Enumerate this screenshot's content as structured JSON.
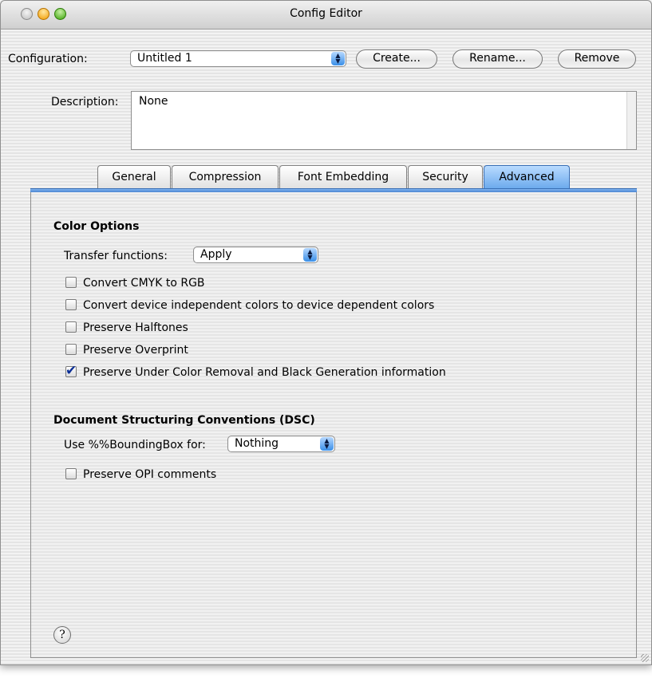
{
  "window": {
    "title": "Config Editor"
  },
  "configuration": {
    "label": "Configuration:",
    "value": "Untitled 1",
    "create_button": "Create...",
    "rename_button": "Rename...",
    "remove_button": "Remove"
  },
  "description": {
    "label": "Description:",
    "value": "None"
  },
  "tabs": [
    {
      "label": "General"
    },
    {
      "label": "Compression"
    },
    {
      "label": "Font Embedding"
    },
    {
      "label": "Security"
    },
    {
      "label": "Advanced",
      "selected": true
    }
  ],
  "color_options": {
    "heading": "Color Options",
    "transfer_label": "Transfer functions:",
    "transfer_value": "Apply",
    "checkboxes": [
      {
        "label": "Convert CMYK to RGB",
        "checked": false
      },
      {
        "label": "Convert device independent colors to device dependent colors",
        "checked": false
      },
      {
        "label": "Preserve Halftones",
        "checked": false
      },
      {
        "label": "Preserve Overprint",
        "checked": false
      },
      {
        "label": "Preserve Under Color Removal and Black Generation information",
        "checked": true
      }
    ]
  },
  "dsc": {
    "heading": "Document Structuring Conventions (DSC)",
    "bbox_label": "Use %%BoundingBox for:",
    "bbox_value": "Nothing",
    "checkboxes": [
      {
        "label": "Preserve OPI comments",
        "checked": false
      }
    ]
  },
  "help": {
    "glyph": "?"
  },
  "colors": {
    "accent": "#6aa9ec",
    "check": "#0c2f96"
  },
  "icons": {
    "check": "✔",
    "popup_arrows": "▲▼"
  }
}
